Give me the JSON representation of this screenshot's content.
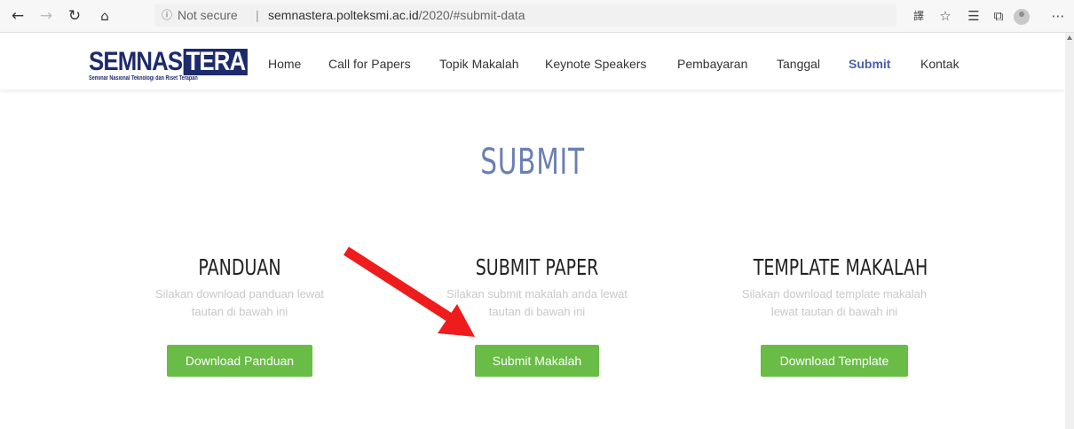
{
  "browser": {
    "security_text": "Not secure",
    "separator": "|",
    "url_domain": "semnastera.polteksmi.ac.id",
    "url_path": "/2020/#submit-data",
    "icons": [
      "back-icon",
      "forward-icon",
      "refresh-icon",
      "home-icon",
      "info-icon",
      "translate-icon",
      "favorite-star-icon",
      "favorites-list-icon",
      "collections-icon",
      "profile-avatar",
      "more-icon"
    ]
  },
  "site": {
    "logo_main_a": "SEMNAS",
    "logo_main_b": "TERA",
    "logo_sub": "Seminar Nasional Teknologi dan Riset Terapan",
    "menu": [
      "Home",
      "Call for Papers",
      "Topik Makalah",
      "Keynote Speakers",
      "Pembayaran",
      "Tanggal",
      "Submit",
      "Kontak"
    ],
    "active_menu": "Submit"
  },
  "main": {
    "title": "SUBMIT",
    "columns": [
      {
        "title": "PANDUAN",
        "desc1": "Silakan download panduan lewat",
        "desc2": "tautan di bawah ini",
        "button": "Download Panduan"
      },
      {
        "title": "SUBMIT PAPER",
        "desc1": "Silakan submit makalah anda lewat",
        "desc2": "tautan di bawah ini",
        "button": "Submit Makalah"
      },
      {
        "title": "TEMPLATE MAKALAH",
        "desc1": "Silakan download template makalah",
        "desc2": "lewat tautan di bawah ini",
        "button": "Download Template"
      }
    ]
  },
  "colors": {
    "accent_blue": "#4a5fa8",
    "title_blue": "#6b7fb3",
    "button_green": "#69bc45",
    "arrow_red": "#ee1c1c",
    "logo_navy": "#1d2a6b"
  }
}
